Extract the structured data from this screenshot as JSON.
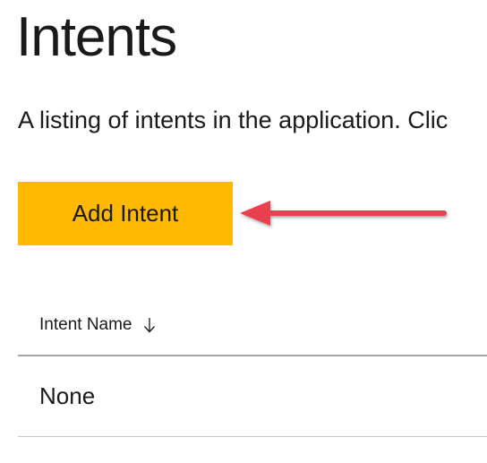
{
  "page": {
    "title": "Intents",
    "description": "A listing of intents in the application. Clic"
  },
  "toolbar": {
    "add_label": "Add Intent",
    "add_color": "#ffb900"
  },
  "annotation": {
    "arrow_color": "#e8414f"
  },
  "table": {
    "columns": [
      {
        "label": "Intent Name",
        "sort": "descending",
        "sort_icon": "arrow-down-icon"
      }
    ],
    "rows": [
      {
        "intent_name": "None"
      }
    ]
  }
}
